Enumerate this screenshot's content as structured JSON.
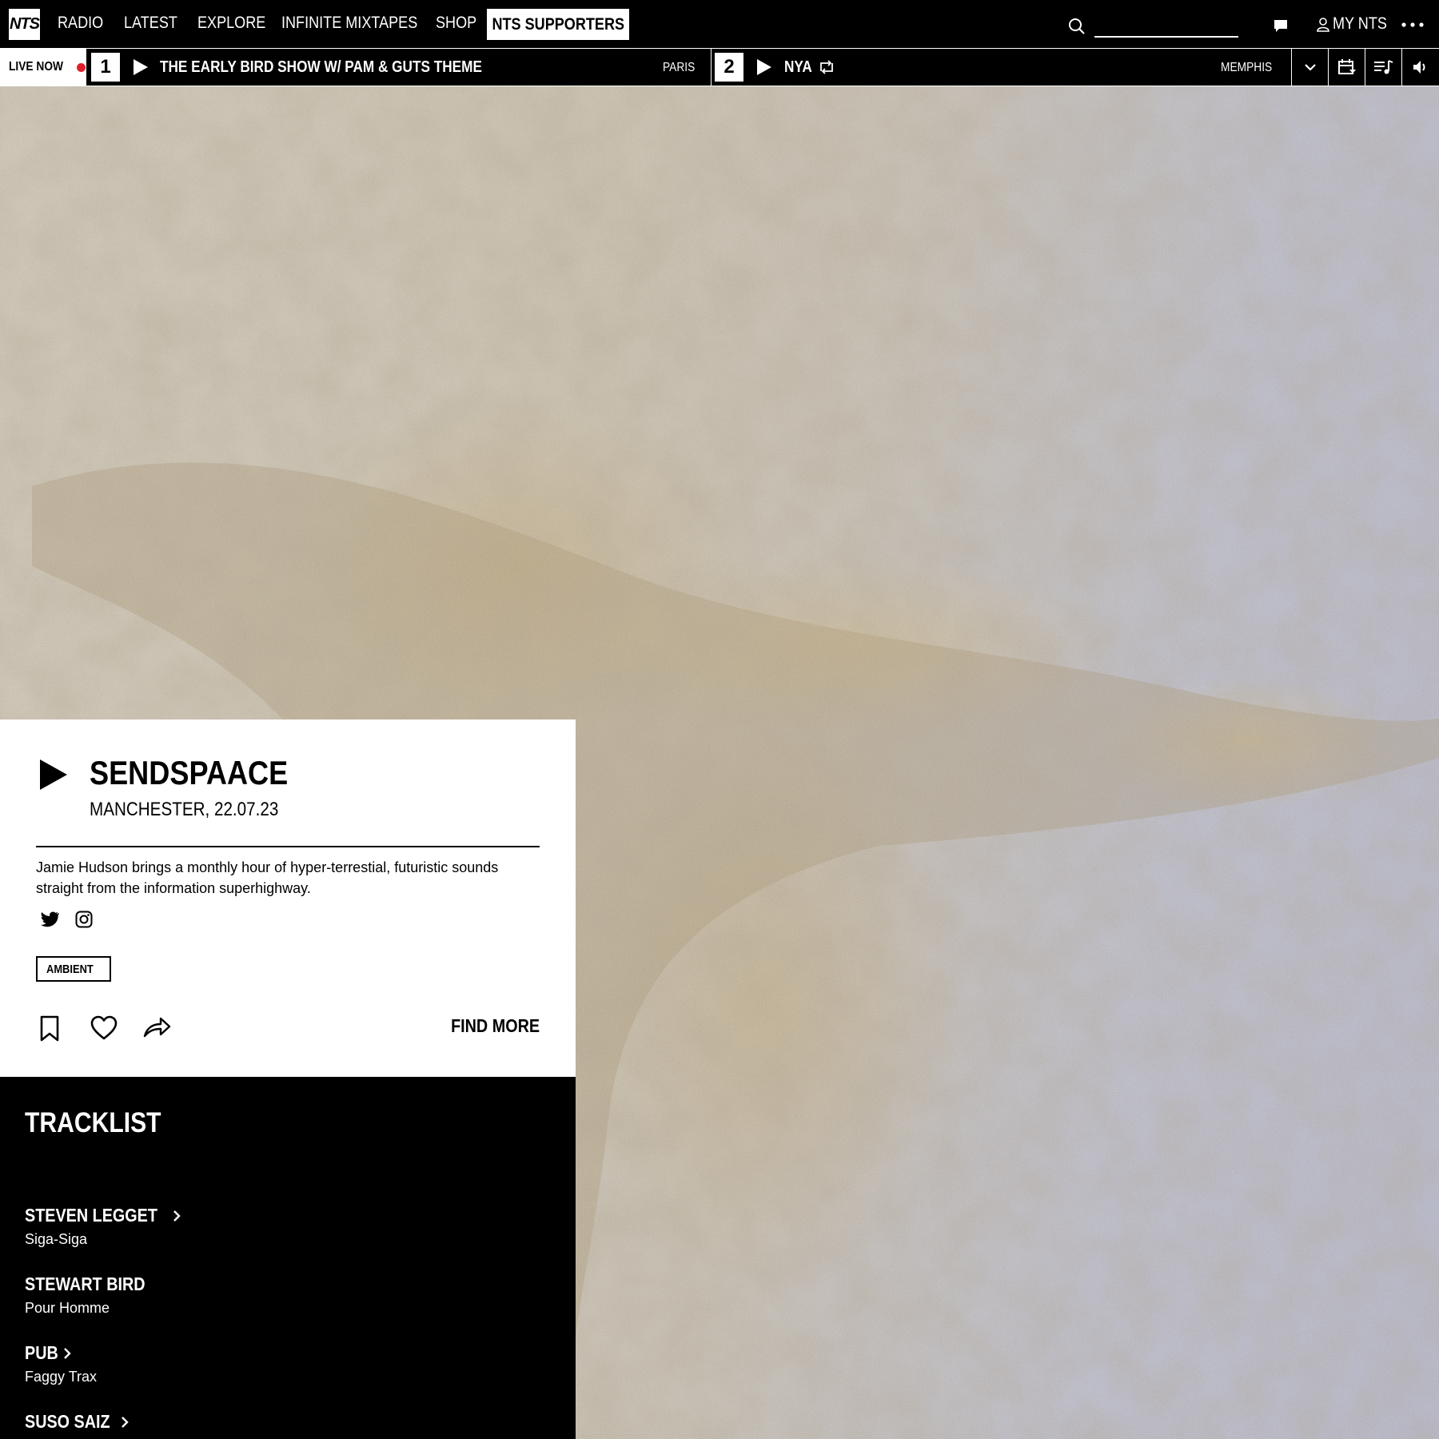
{
  "brand": {
    "logo_text": "NTS"
  },
  "nav": {
    "items": [
      "RADIO",
      "LATEST",
      "EXPLORE",
      "INFINITE MIXTAPES",
      "SHOP"
    ],
    "supporters": "NTS SUPPORTERS",
    "search_placeholder": "",
    "my_nts": "MY NTS"
  },
  "live": {
    "label": "LIVE NOW",
    "channels": [
      {
        "number": "1",
        "title": "THE EARLY BIRD SHOW W/ PAM & GUTS THEME",
        "location": "PARIS"
      },
      {
        "number": "2",
        "title": "NYA",
        "location": "MEMPHIS"
      }
    ]
  },
  "show": {
    "title": "SENDSPAACE",
    "subtitle": "MANCHESTER, 22.07.23",
    "description": "Jamie Hudson brings a monthly hour of hyper-terrestial, futuristic sounds straight from the information superhighway.",
    "genre": "AMBIENT",
    "find_more": "FIND MORE"
  },
  "tracklist": {
    "heading": "TRACKLIST",
    "tracks": [
      {
        "artist": "STEVEN LEGGET",
        "title": "Siga-Siga",
        "link": true
      },
      {
        "artist": "STEWART BIRD",
        "title": "Pour Homme",
        "link": false
      },
      {
        "artist": "PUB",
        "title": "Faggy Trax",
        "link": true
      },
      {
        "artist": "SUSO SAIZ",
        "title": "",
        "link": true
      }
    ]
  },
  "colors": {
    "live_dot": "#e0202a",
    "background": "#000000",
    "card": "#ffffff"
  }
}
